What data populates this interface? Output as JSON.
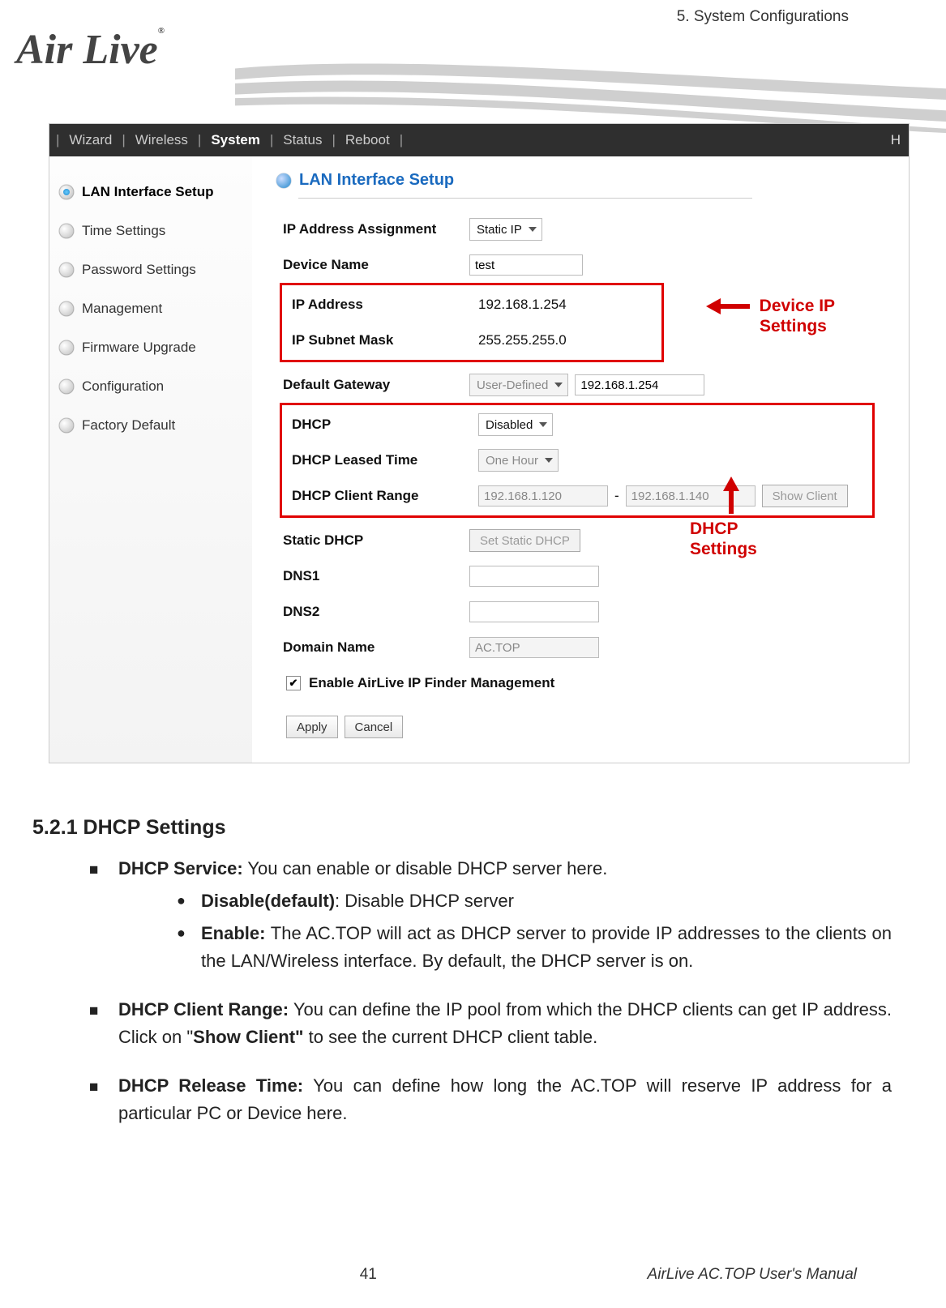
{
  "header": {
    "chapter": "5.  System  Configurations"
  },
  "logo": {
    "text": "Air Live",
    "reg": "®"
  },
  "nav": {
    "items": [
      "Wizard",
      "Wireless",
      "System",
      "Status",
      "Reboot"
    ],
    "active_index": 2
  },
  "sidebar": {
    "items": [
      {
        "label": "LAN Interface Setup",
        "active": true
      },
      {
        "label": "Time Settings",
        "active": false
      },
      {
        "label": "Password Settings",
        "active": false
      },
      {
        "label": "Management",
        "active": false
      },
      {
        "label": "Firmware Upgrade",
        "active": false
      },
      {
        "label": "Configuration",
        "active": false
      },
      {
        "label": "Factory Default",
        "active": false
      }
    ]
  },
  "panel": {
    "title": "LAN Interface Setup",
    "rows": {
      "ip_assign_label": "IP Address Assignment",
      "ip_assign_value": "Static IP",
      "device_name_label": "Device Name",
      "device_name_value": "test",
      "ip_address_label": "IP Address",
      "ip_address_value": "192.168.1.254",
      "subnet_label": "IP Subnet Mask",
      "subnet_value": "255.255.255.0",
      "gateway_label": "Default Gateway",
      "gateway_mode": "User-Defined",
      "gateway_value": "192.168.1.254",
      "dhcp_label": "DHCP",
      "dhcp_value": "Disabled",
      "lease_label": "DHCP Leased Time",
      "lease_value": "One Hour",
      "range_label": "DHCP Client Range",
      "range_start": "192.168.1.120",
      "range_sep": "-",
      "range_end": "192.168.1.140",
      "show_client_btn": "Show Client",
      "static_dhcp_label": "Static DHCP",
      "static_dhcp_btn": "Set Static DHCP",
      "dns1_label": "DNS1",
      "dns2_label": "DNS2",
      "domain_label": "Domain Name",
      "domain_value": "AC.TOP",
      "finder_check_label": "Enable AirLive IP Finder Management",
      "apply_btn": "Apply",
      "cancel_btn": "Cancel"
    }
  },
  "annotations": {
    "device_ip_l1": "Device IP",
    "device_ip_l2": "Settings",
    "dhcp_l1": "DHCP",
    "dhcp_l2": "Settings"
  },
  "doc": {
    "heading": "5.2.1 DHCP Settings",
    "b1_strong": "DHCP Service:",
    "b1_rest": " You can enable or disable DHCP server here.",
    "b1a_strong": "Disable(default)",
    "b1a_rest": ": Disable DHCP server",
    "b1b_strong": "Enable:",
    "b1b_rest": " The AC.TOP will act as DHCP server to provide IP addresses to the clients on the LAN/Wireless interface. By default, the DHCP server is on.",
    "b2_strong": "DHCP Client Range:",
    "b2_rest_a": " You can define the IP pool from which the DHCP clients can get IP address. Click on \"",
    "b2_strong2": "Show Client\"",
    "b2_rest_b": " to see the current DHCP client table.",
    "b3_strong": "DHCP Release Time:",
    "b3_rest": " You can define how long the AC.TOP will reserve IP address for a particular PC or Device here."
  },
  "footer": {
    "page": "41",
    "title": "AirLive AC.TOP User's Manual"
  }
}
